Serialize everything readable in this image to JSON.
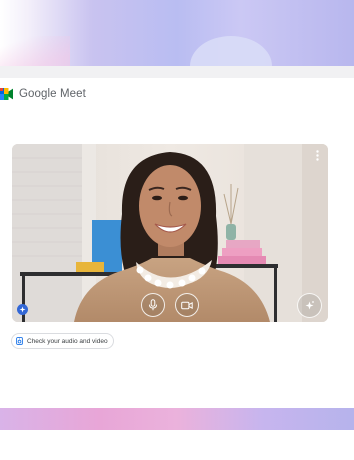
{
  "app": {
    "name": "Google Meet",
    "logo_colors": [
      "#00832d",
      "#0066da",
      "#e94235",
      "#2684fc",
      "#00ac47",
      "#ffba00"
    ]
  },
  "preview": {
    "mic_icon": "microphone-icon",
    "camera_icon": "video-camera-icon",
    "effects_icon": "sparkle-effects-icon",
    "menu_icon": "more-vert-icon",
    "badge_icon": "visual-effects-icon",
    "mic_state": "off"
  },
  "check_audio": {
    "label": "Check your audio and video",
    "icon": "speaker-check-icon"
  },
  "colors": {
    "accent": "#1a73e8",
    "top_gradient_start": "#c9c3f0",
    "bottom_gradient": "#e8a6d7"
  }
}
